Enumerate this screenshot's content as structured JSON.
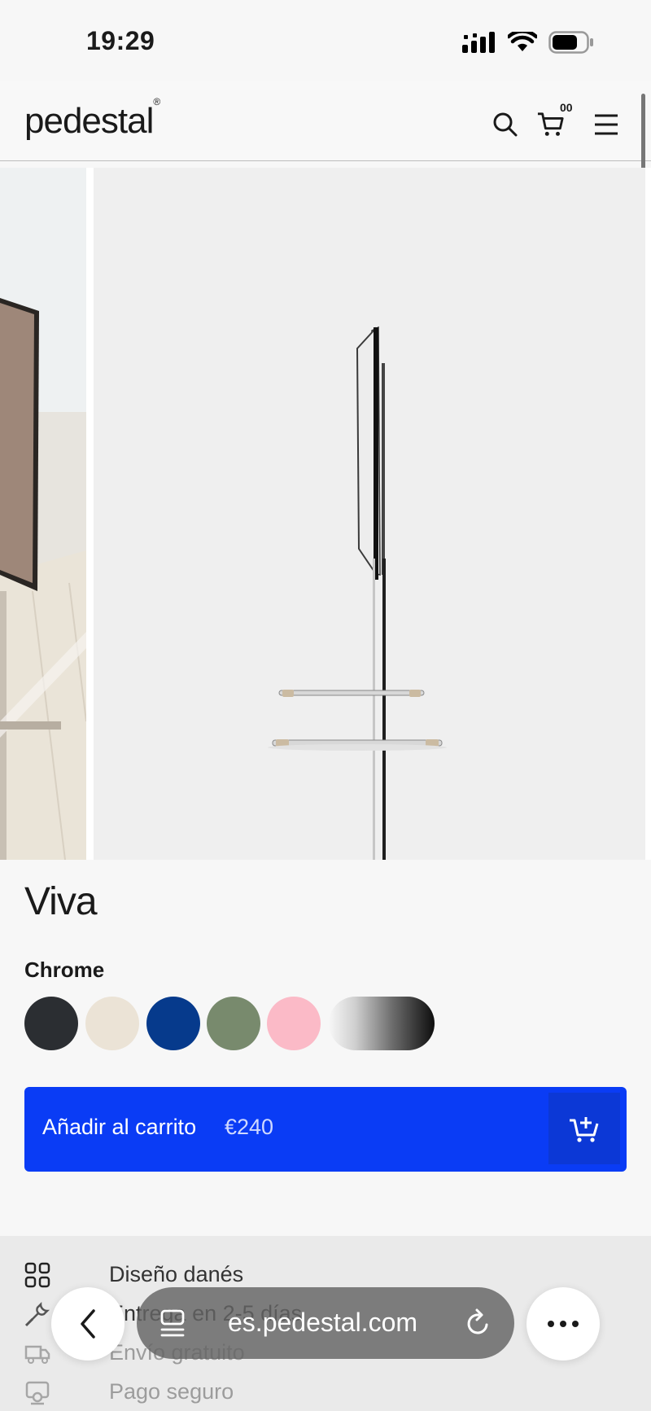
{
  "status_bar": {
    "time": "19:29"
  },
  "header": {
    "logo": "pedestal",
    "logo_mark": "®",
    "cart_count": "00",
    "icons": [
      "search-icon",
      "cart-icon",
      "hamburger-menu-icon"
    ]
  },
  "gallery": {
    "images": [
      "tv-stand-room-photo",
      "tv-stand-side-view"
    ]
  },
  "product": {
    "name": "Viva",
    "selected_variant": "Chrome",
    "swatches": [
      {
        "name": "black",
        "color": "#2b2e32"
      },
      {
        "name": "cream",
        "color": "#ebe3d6"
      },
      {
        "name": "blue",
        "color": "#063a8c"
      },
      {
        "name": "green",
        "color": "#788a6d"
      },
      {
        "name": "pink",
        "color": "#fbbac7"
      },
      {
        "name": "chrome",
        "color": "linear-gradient"
      }
    ],
    "add_to_cart": {
      "label": "Añadir al carrito",
      "price": "€240"
    }
  },
  "features": [
    {
      "icon": "grid-icon",
      "label": "Diseño danés"
    },
    {
      "icon": "wrench-icon",
      "label": "Entrega en 2-5 días"
    },
    {
      "icon": "truck-icon",
      "label": "Envío gratuito"
    },
    {
      "icon": "secure-payment-icon",
      "label": "Pago seguro"
    }
  ],
  "browser": {
    "url": "es.pedestal.com",
    "icons": [
      "back-arrow-icon",
      "tabs-icon",
      "reload-icon",
      "more-icon"
    ]
  },
  "colors": {
    "accent": "#0a3cf5",
    "accent_dark": "#0c38d6"
  }
}
